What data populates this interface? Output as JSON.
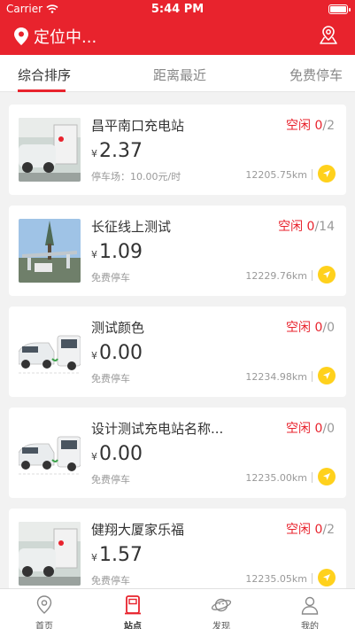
{
  "status_bar": {
    "carrier": "Carrier",
    "time": "5:44 PM"
  },
  "header": {
    "location_label": "定位中..."
  },
  "tabs": [
    {
      "label": "综合排序",
      "active": true
    },
    {
      "label": "距离最近",
      "active": false
    },
    {
      "label": "免费停车",
      "active": false
    }
  ],
  "stations": [
    {
      "name": "昌平南口充电站",
      "status_label": "空闲",
      "free": "0",
      "total": "/2",
      "currency": "¥",
      "price": "2.37",
      "parking": "停车场：10.00元/时",
      "distance": "12205.75km"
    },
    {
      "name": "长征线上测试",
      "status_label": "空闲",
      "free": "0",
      "total": "/14",
      "currency": "¥",
      "price": "1.09",
      "parking": "免费停车",
      "distance": "12229.76km"
    },
    {
      "name": "测试颜色",
      "status_label": "空闲",
      "free": "0",
      "total": "/0",
      "currency": "¥",
      "price": "0.00",
      "parking": "免费停车",
      "distance": "12234.98km"
    },
    {
      "name": "设计测试充电站名称...",
      "status_label": "空闲",
      "free": "0",
      "total": "/0",
      "currency": "¥",
      "price": "0.00",
      "parking": "免费停车",
      "distance": "12235.00km"
    },
    {
      "name": "健翔大厦家乐福",
      "status_label": "空闲",
      "free": "0",
      "total": "/2",
      "currency": "¥",
      "price": "1.57",
      "parking": "免费停车",
      "distance": "12235.05km"
    }
  ],
  "tabbar": [
    {
      "label": "首页",
      "icon": "home-pin-icon"
    },
    {
      "label": "站点",
      "icon": "station-icon",
      "active": true
    },
    {
      "label": "发现",
      "icon": "planet-icon"
    },
    {
      "label": "我的",
      "icon": "user-icon"
    }
  ],
  "colors": {
    "brand": "#e8232d",
    "accent": "#ffd11c"
  }
}
